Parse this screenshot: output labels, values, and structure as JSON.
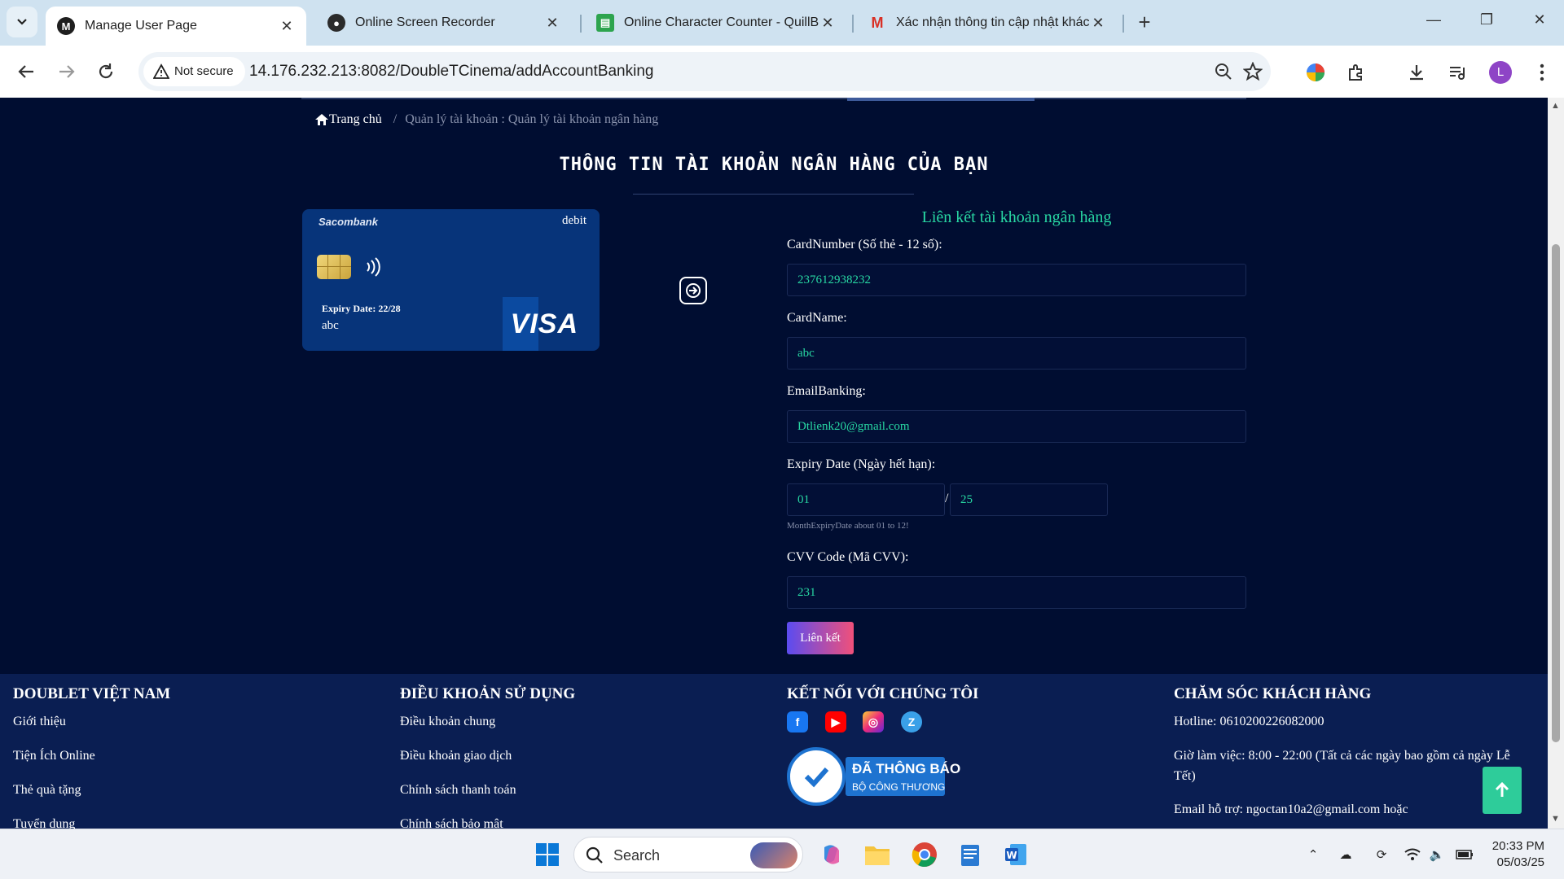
{
  "browser": {
    "tabs": [
      {
        "title": "Manage User Page",
        "active": true
      },
      {
        "title": "Online Screen Recorder",
        "active": false
      },
      {
        "title": "Online Character Counter - QuillBot",
        "active": false
      },
      {
        "title": "Xác nhận thông tin cập nhật khách",
        "active": false
      }
    ],
    "security_label": "Not secure",
    "url": "14.176.232.213:8082/DoubleTCinema/addAccountBanking",
    "profile_initial": "L"
  },
  "breadcrumb": {
    "home": "Trang chủ",
    "separator": "/",
    "current": "Quản lý tài khoản : Quản lý tài khoản ngân hàng"
  },
  "page_title": "THÔNG TIN TÀI KHOẢN NGÂN HÀNG CỦA BẠN",
  "card": {
    "bank": "Sacombank",
    "type": "debit",
    "expiry": "Expiry Date: 22/28",
    "holder": "abc",
    "brand": "VISA"
  },
  "form": {
    "title": "Liên kết tài khoản ngân hàng",
    "card_number_label": "CardNumber (Số thẻ - 12 số):",
    "card_number": "237612938232",
    "card_name_label": "CardName:",
    "card_name": "abc",
    "email_label": "EmailBanking:",
    "email": "Dtlienk20@gmail.com",
    "expiry_label": "Expiry Date (Ngày hết hạn):",
    "expiry_month": "01",
    "expiry_separator": "/",
    "expiry_year": "25",
    "expiry_hint": "MonthExpiryDate about 01 to 12!",
    "cvv_label": "CVV Code (Mã CVV):",
    "cvv": "231",
    "submit_label": "Liên kết"
  },
  "footer": {
    "col1": {
      "heading": "DOUBLET VIỆT NAM",
      "links": [
        "Giới thiệu",
        "Tiện Ích Online",
        "Thẻ quà tặng",
        "Tuyển dụng"
      ]
    },
    "col2": {
      "heading": "ĐIỀU KHOẢN SỬ DỤNG",
      "links": [
        "Điều khoản chung",
        "Điều khoản giao dịch",
        "Chính sách thanh toán",
        "Chính sách bảo mật"
      ]
    },
    "col3": {
      "heading": "KẾT NỐI VỚI CHÚNG TÔI",
      "badge_line1": "ĐÃ THÔNG BÁO",
      "badge_line2": "BỘ CÔNG THƯƠNG"
    },
    "col4": {
      "heading": "CHĂM SÓC KHÁCH HÀNG",
      "hotline": "Hotline: 0610200226082000",
      "hours": "Giờ làm việc: 8:00 - 22:00 (Tất cả các ngày bao gồm cả ngày Lễ Tết)",
      "email": "Email hỗ trợ: ngoctan10a2@gmail.com hoặc"
    }
  },
  "taskbar": {
    "search_label": "Search",
    "time": "20:33 PM",
    "date": "05/03/25"
  },
  "colors": {
    "page_bg": "#000d31",
    "accent_green": "#28d8a3",
    "footer_bg": "#0a1e52",
    "card_bg": "#07347a"
  }
}
